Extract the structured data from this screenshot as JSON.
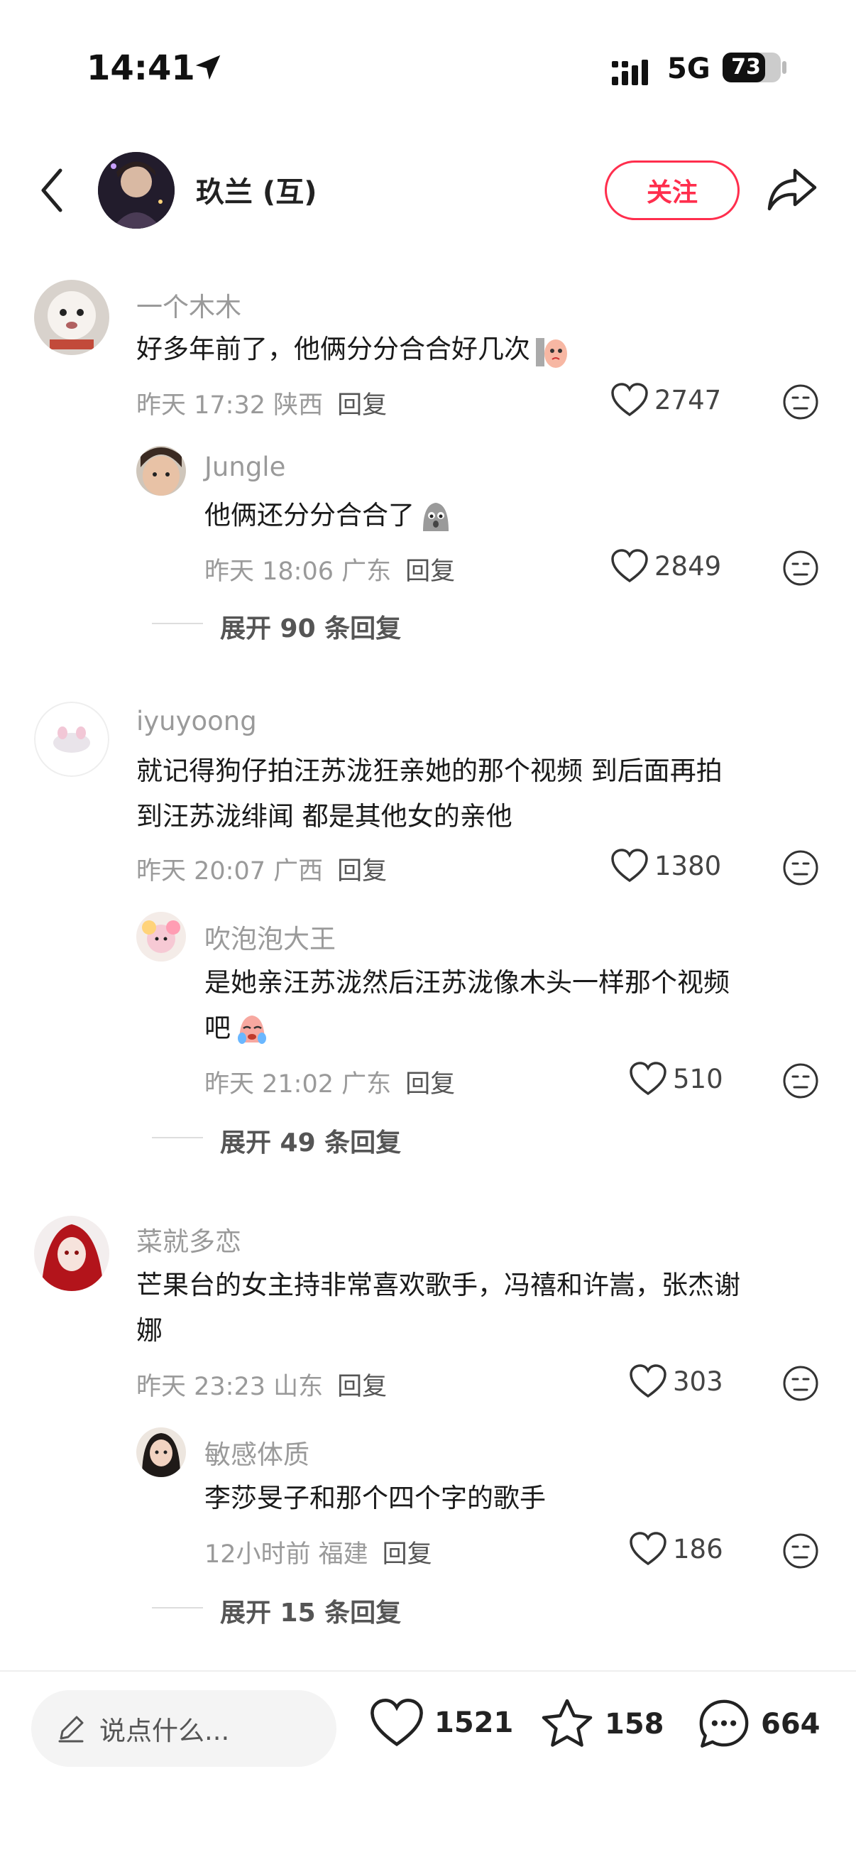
{
  "status_bar": {
    "time": "14:41",
    "network": "5G",
    "battery": "73",
    "battery_level": 0.73
  },
  "header": {
    "author_name": "玖兰 (互)",
    "follow_label": "关注"
  },
  "comments": [
    {
      "user": "一个木木",
      "text": "好多年前了，他俩分分合合好几次",
      "time": "昨天 17:32 陕西",
      "reply": "回复",
      "likes": "2747",
      "replies": [
        {
          "user": "Jungle",
          "text": "他俩还分分合合了",
          "time": "昨天 18:06 广东",
          "reply": "回复",
          "likes": "2849"
        }
      ],
      "expand": "展开 90 条回复"
    },
    {
      "user": "iyuyoong",
      "text_line1": "就记得狗仔拍汪苏泷狂亲她的那个视频 到后面再拍",
      "text_line2": "到汪苏泷绯闻 都是其他女的亲他",
      "time": "昨天 20:07 广西",
      "reply": "回复",
      "likes": "1380",
      "replies": [
        {
          "user": "吹泡泡大王",
          "text_line1": "是她亲汪苏泷然后汪苏泷像木头一样那个视频",
          "text_line2": "吧",
          "time": "昨天 21:02 广东",
          "reply": "回复",
          "likes": "510"
        }
      ],
      "expand": "展开 49 条回复"
    },
    {
      "user": "菜就多恋",
      "text_line1": "芒果台的女主持非常喜欢歌手，冯禧和许嵩，张杰谢",
      "text_line2": "娜",
      "time": "昨天 23:23 山东",
      "reply": "回复",
      "likes": "303",
      "replies": [
        {
          "user": "敏感体质",
          "text": "李莎旻子和那个四个字的歌手",
          "time": "12小时前 福建",
          "reply": "回复",
          "likes": "186"
        }
      ],
      "expand": "展开 15 条回复"
    }
  ],
  "bottom_bar": {
    "input_placeholder": "说点什么...",
    "likes": "1521",
    "favorites": "158",
    "comments": "664"
  },
  "colors": {
    "accent": "#ff2e4d",
    "muted_text": "#9a9a9a"
  }
}
